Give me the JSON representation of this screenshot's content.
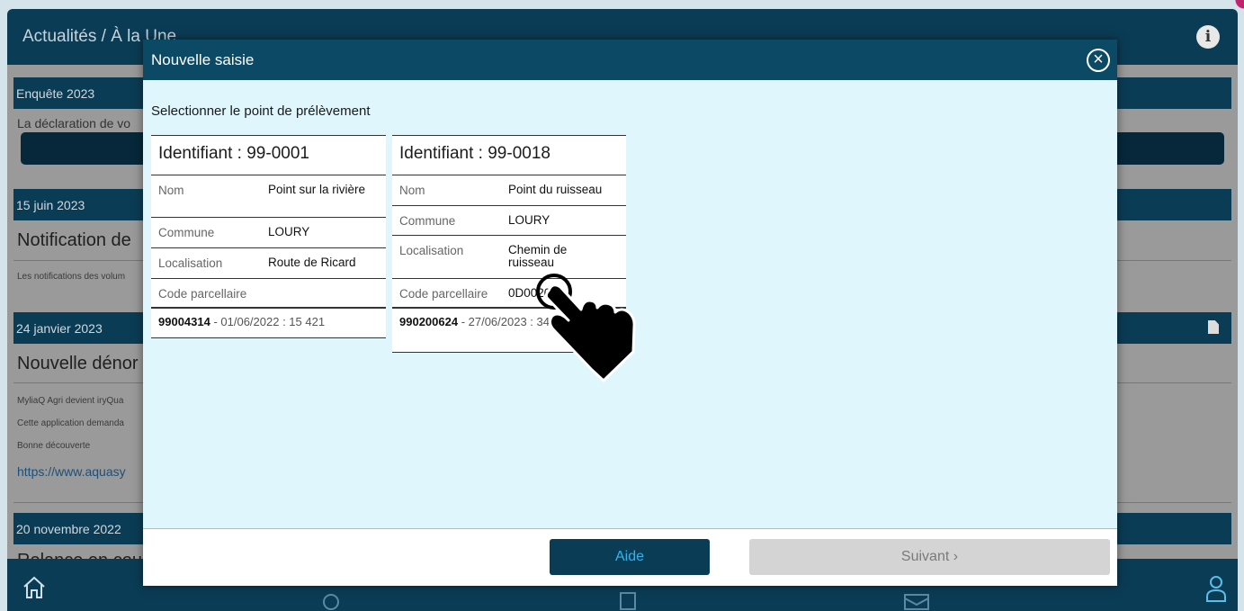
{
  "app": {
    "title": "Actualités / À la Une",
    "news": [
      {
        "bar": "Enquête 2023",
        "text": "La déclaration de vo"
      },
      {
        "bar": "15 juin 2023",
        "heading": "Notification de",
        "small": "Les notifications des volum"
      },
      {
        "bar": "24 janvier 2023",
        "heading": "Nouvelle dénor",
        "lines": [
          "MyliaQ Agri devient iryQua",
          "Cette application demanda",
          "Bonne découverte"
        ],
        "link": "https://www.aquasy"
      },
      {
        "bar": "20 novembre 2022",
        "heading": "Relance en cou"
      }
    ]
  },
  "modal": {
    "title": "Nouvelle saisie",
    "instruction": "Selectionner le point de prélèvement",
    "cards": [
      {
        "id": "Identifiant : 99-0001",
        "rows": [
          {
            "label": "Nom",
            "value": "Point sur la rivière"
          },
          {
            "label": "Commune",
            "value": "LOURY"
          },
          {
            "label": "Localisation",
            "value": "Route de Ricard"
          },
          {
            "label": "Code parcellaire",
            "value": ""
          }
        ],
        "footer_bold": "99004314",
        "footer_rest": " - 01/06/2022 : 15 421"
      },
      {
        "id": "Identifiant : 99-0018",
        "rows": [
          {
            "label": "Nom",
            "value": "Point du ruisseau"
          },
          {
            "label": "Commune",
            "value": "LOURY"
          },
          {
            "label": "Localisation",
            "value": "Chemin de ruisseau"
          },
          {
            "label": "Code parcellaire",
            "value": "0D0020"
          }
        ],
        "footer_bold": "990200624",
        "footer_rest": " - 27/06/2023 : 345"
      }
    ],
    "help_label": "Aide",
    "next_label": "Suivant ›"
  }
}
